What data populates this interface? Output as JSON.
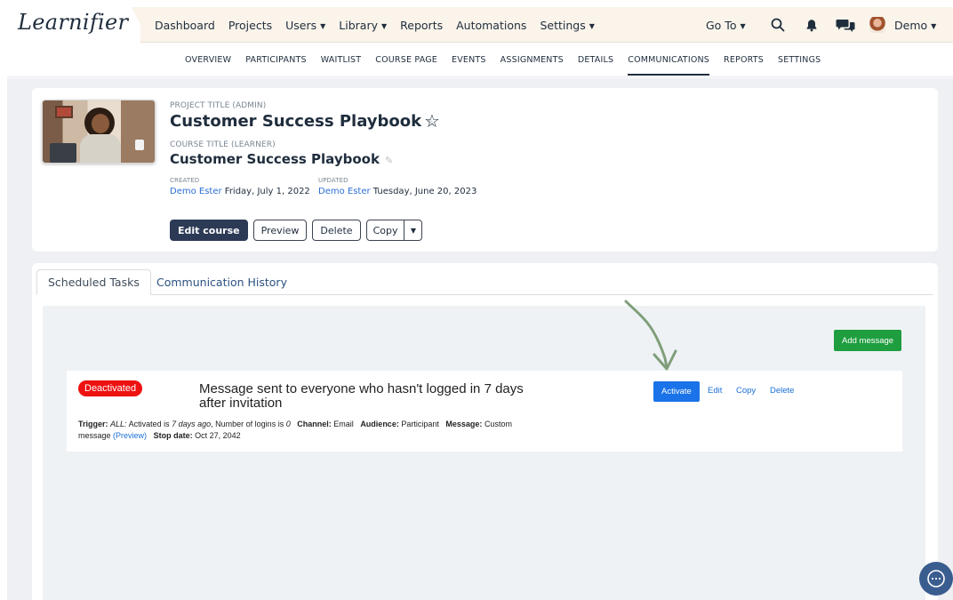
{
  "app": {
    "logo": "Learnifier"
  },
  "nav": {
    "dashboard": "Dashboard",
    "projects": "Projects",
    "users": "Users",
    "library": "Library",
    "reports": "Reports",
    "automations": "Automations",
    "settings": "Settings",
    "goto": "Go To",
    "user_name": "Demo"
  },
  "subnav": [
    "OVERVIEW",
    "PARTICIPANTS",
    "WAITLIST",
    "COURSE PAGE",
    "EVENTS",
    "ASSIGNMENTS",
    "DETAILS",
    "COMMUNICATIONS",
    "REPORTS",
    "SETTINGS"
  ],
  "subnav_active": "COMMUNICATIONS",
  "course": {
    "project_title_label": "PROJECT TITLE (ADMIN)",
    "project_title": "Customer Success Playbook",
    "course_title_label": "COURSE TITLE (LEARNER)",
    "course_title": "Customer Success Playbook",
    "created_label": "CREATED",
    "created_by": "Demo Ester",
    "created_date": "Friday, July 1, 2022",
    "updated_label": "UPDATED",
    "updated_by": "Demo Ester",
    "updated_date": "Tuesday, June 20, 2023",
    "buttons": {
      "edit": "Edit course",
      "preview": "Preview",
      "delete": "Delete",
      "copy": "Copy"
    }
  },
  "tabs": {
    "scheduled": "Scheduled Tasks",
    "history": "Communication History"
  },
  "panel": {
    "add_message": "Add message"
  },
  "task": {
    "status": "Deactivated",
    "title": "Message sent to everyone who hasn't logged in 7 days after invitation",
    "actions": {
      "activate": "Activate",
      "edit": "Edit",
      "copy": "Copy",
      "delete": "Delete"
    },
    "trigger_label": "Trigger:",
    "trigger_all": "ALL:",
    "trigger_text_1": "Activated is",
    "trigger_value_1": "7 days ago",
    "trigger_text_2": ", Number of logins is",
    "trigger_value_2": "0",
    "channel_label": "Channel:",
    "channel": "Email",
    "audience_label": "Audience:",
    "audience": "Participant",
    "message_label": "Message:",
    "message": "Custom message",
    "preview_link": "(Preview)",
    "stop_label": "Stop date:",
    "stop_date": "Oct 27, 2042"
  },
  "colors": {
    "accent_green": "#1e9e3e",
    "accent_blue": "#1a73e8",
    "deactivated_red": "#ee1111",
    "dark_button": "#2c3a55"
  }
}
